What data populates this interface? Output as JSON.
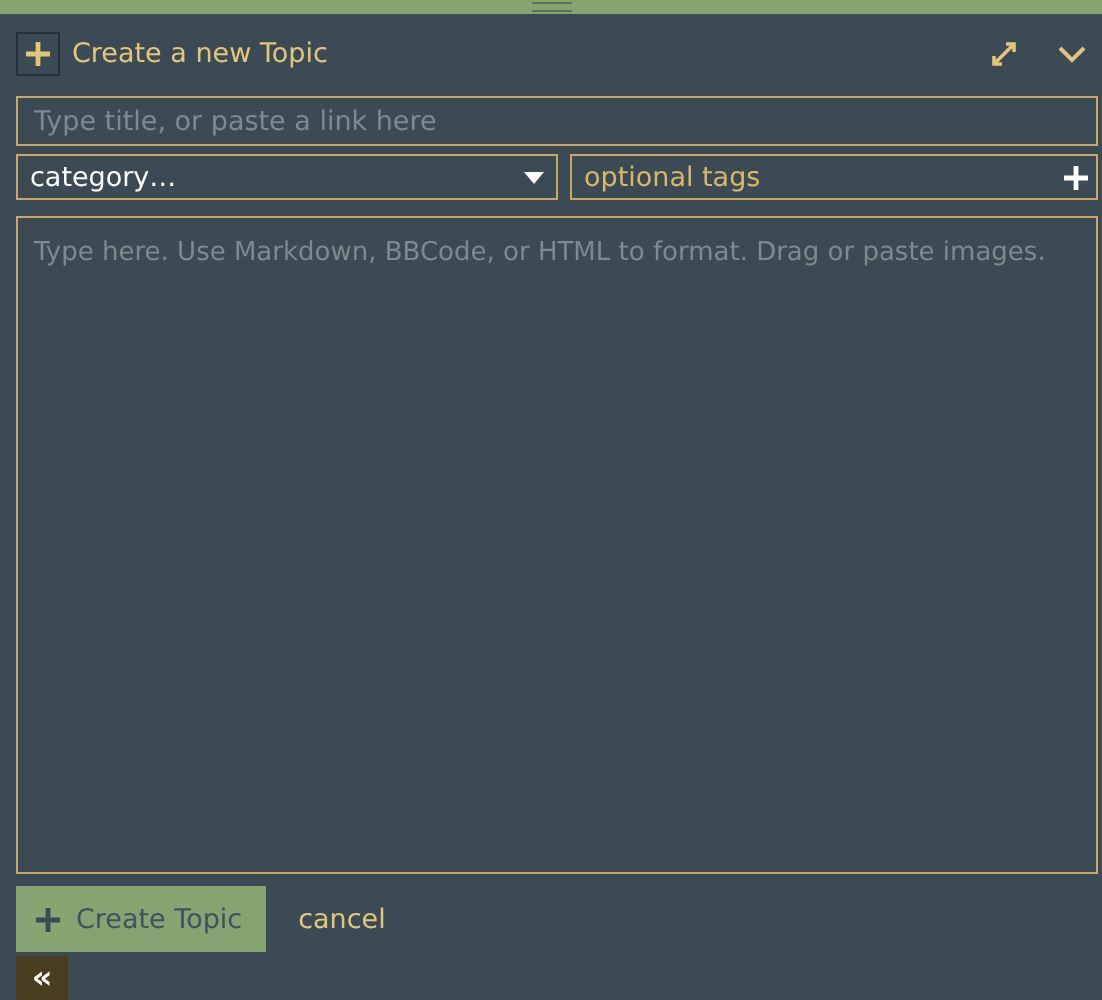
{
  "composer": {
    "title": "Create a new Topic",
    "title_field": {
      "placeholder": "Type title, or paste a link here"
    },
    "category": {
      "value": "category…"
    },
    "tags": {
      "placeholder": "optional tags"
    },
    "body": {
      "placeholder": "Type here. Use Markdown, BBCode, or HTML to format. Drag or paste images."
    },
    "submit": {
      "label": "Create Topic"
    },
    "cancel": {
      "label": "cancel"
    },
    "collapse": {
      "label": "«"
    }
  }
}
